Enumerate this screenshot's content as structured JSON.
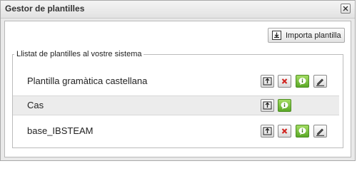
{
  "dialog": {
    "title": "Gestor de plantilles",
    "close_icon": "close-icon"
  },
  "toolbar": {
    "import_label": "Importa plantilla",
    "import_icon": "import-icon"
  },
  "templates": {
    "legend": "Llistat de plantilles al vostre sistema",
    "rows": [
      {
        "name": "Plantilla gramàtica castellana",
        "actions": [
          "export",
          "delete",
          "info",
          "edit"
        ]
      },
      {
        "name": "Cas",
        "actions": [
          "export",
          "info"
        ]
      },
      {
        "name": "base_IBSTEAM",
        "actions": [
          "export",
          "delete",
          "info",
          "edit"
        ]
      }
    ]
  },
  "colors": {
    "info_green": "#5aa826",
    "delete_red": "#d0231e",
    "title_bar": "#e2e2e2"
  }
}
